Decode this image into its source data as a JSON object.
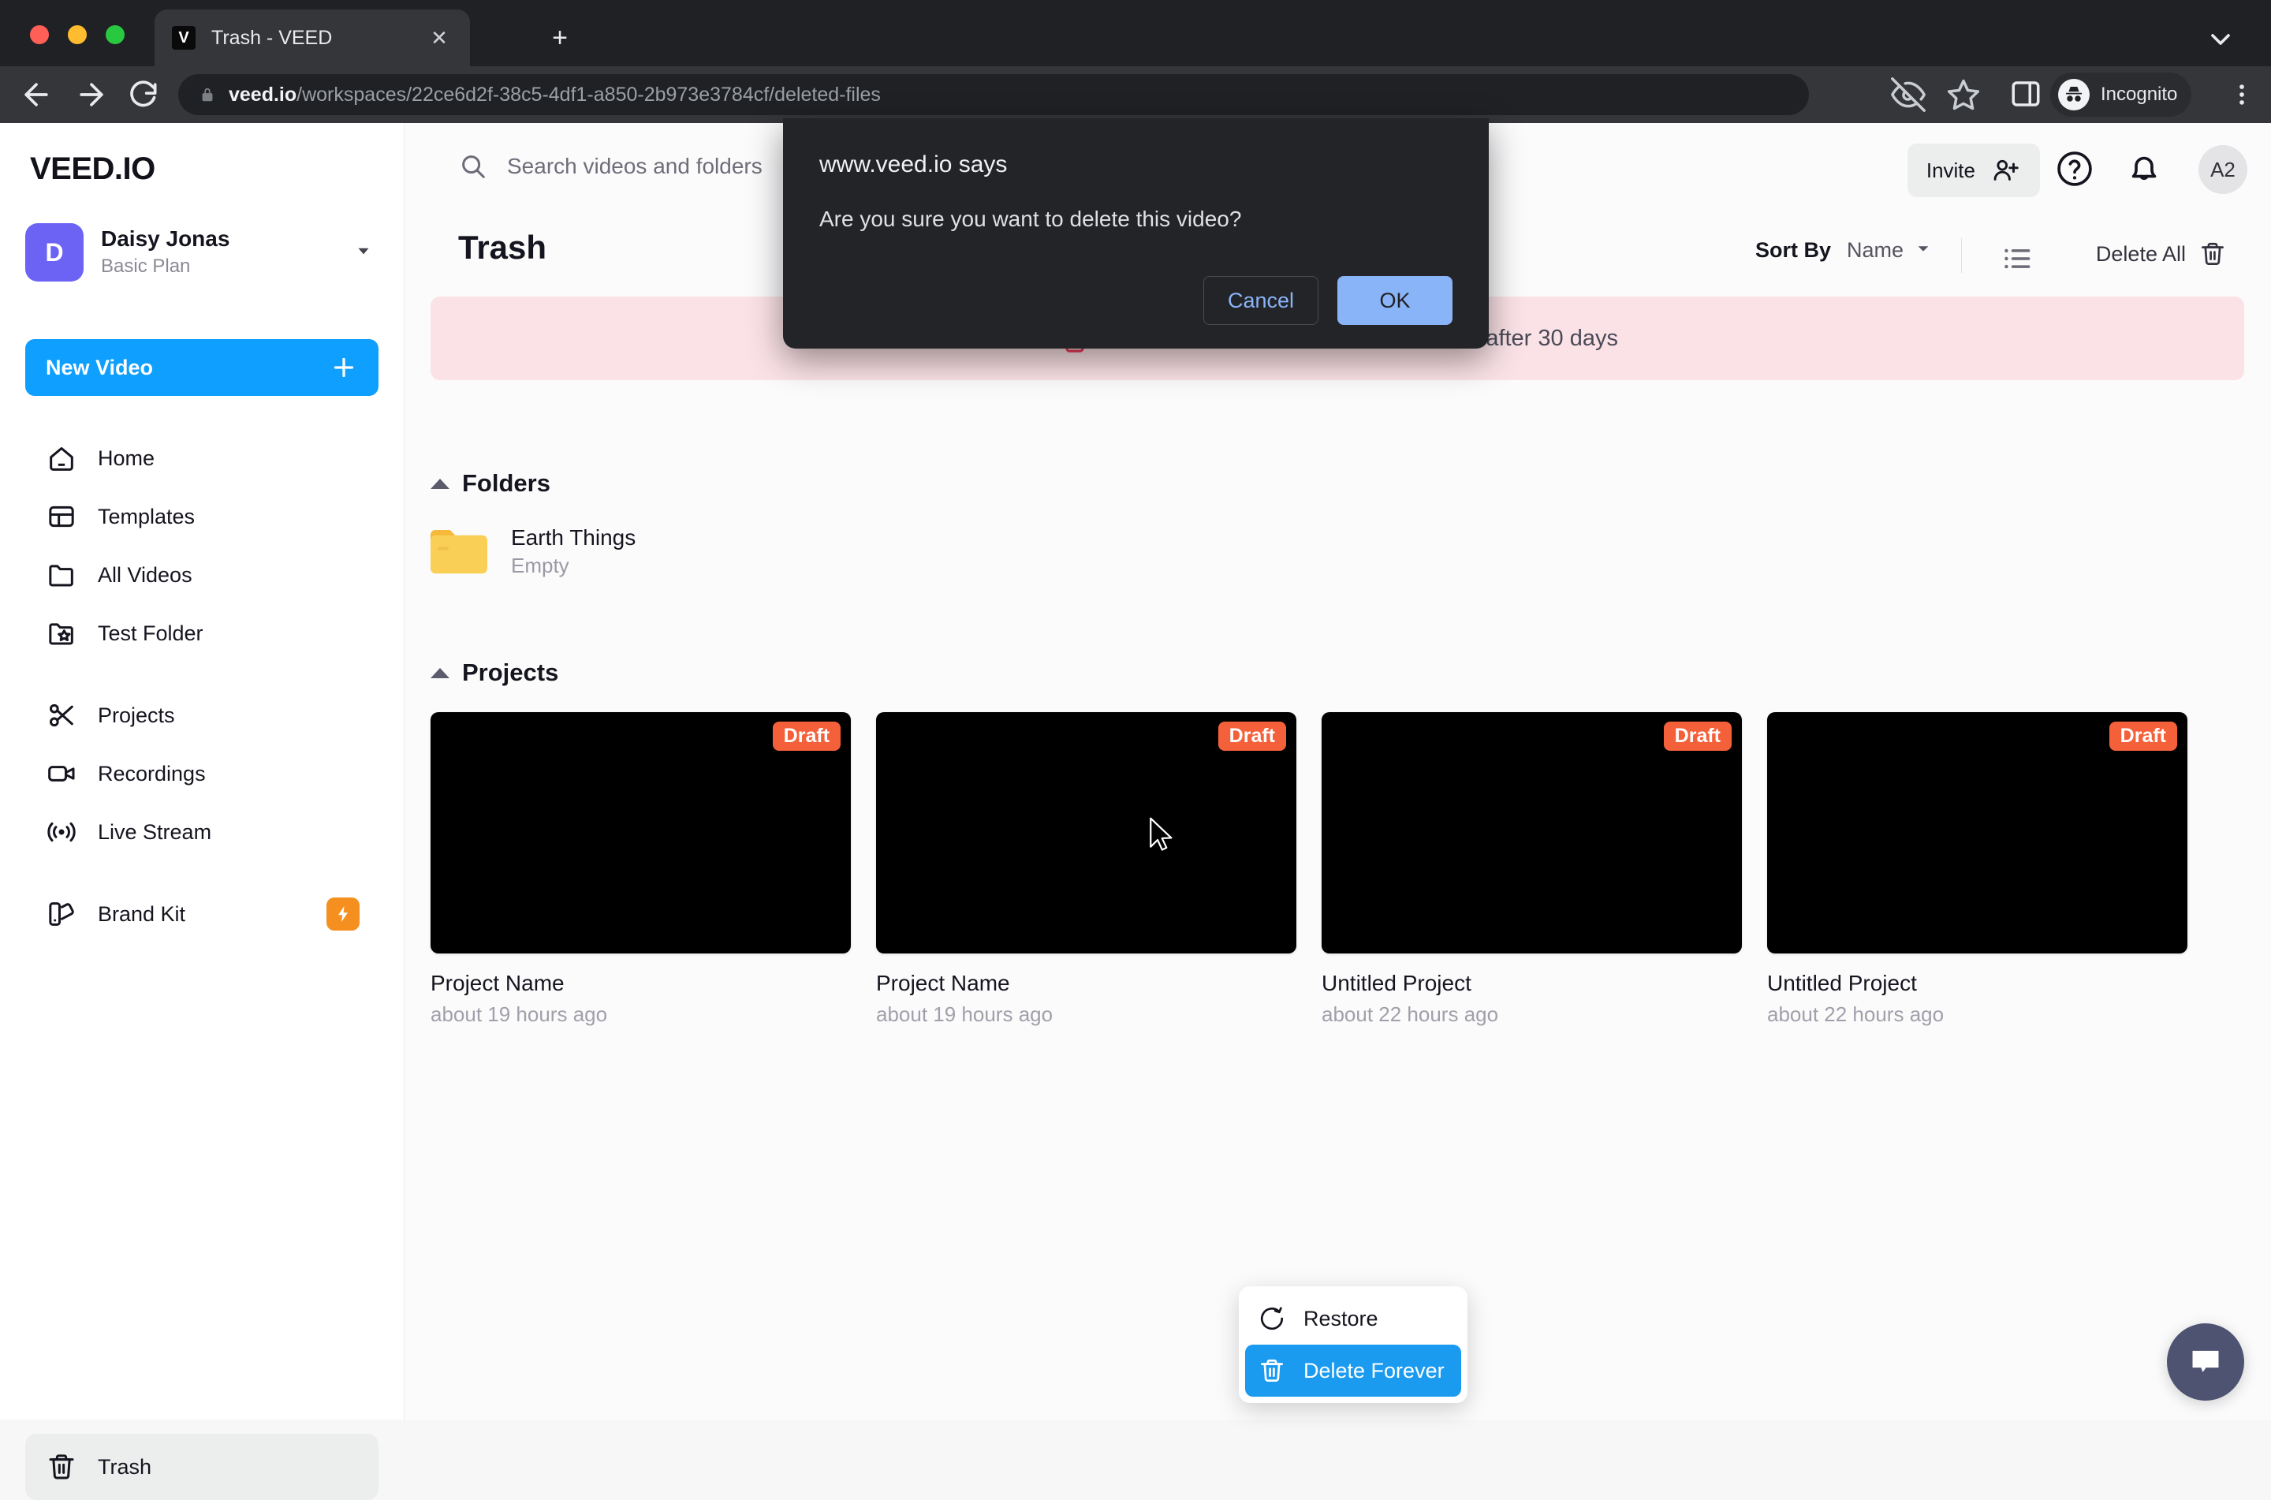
{
  "browser": {
    "tab": {
      "title": "Trash - VEED",
      "favicon_letter": "V"
    },
    "new_tab_label": "+",
    "url_host": "veed.io",
    "url_path": "/workspaces/22ce6d2f-38c5-4df1-a850-2b973e3784cf/deleted-files",
    "profile_label": "Incognito"
  },
  "dialog": {
    "title": "www.veed.io says",
    "message": "Are you sure you want to delete this video?",
    "cancel_label": "Cancel",
    "ok_label": "OK",
    "ok_color": "#8ab4f8"
  },
  "sidebar": {
    "brand": "VEED.IO",
    "account": {
      "initial": "D",
      "name": "Daisy Jonas",
      "plan": "Basic Plan"
    },
    "new_video_label": "New Video",
    "items": [
      {
        "label": "Home",
        "icon": "home-icon"
      },
      {
        "label": "Templates",
        "icon": "templates-icon"
      },
      {
        "label": "All Videos",
        "icon": "folder-icon"
      },
      {
        "label": "Test Folder",
        "icon": "folder-star-icon"
      },
      {
        "label": "Projects",
        "icon": "scissors-icon"
      },
      {
        "label": "Recordings",
        "icon": "video-camera-icon"
      },
      {
        "label": "Live Stream",
        "icon": "broadcast-icon"
      },
      {
        "label": "Brand Kit",
        "icon": "brand-kit-icon",
        "badge": "pro-bolt"
      }
    ],
    "trash_label": "Trash"
  },
  "header": {
    "search_placeholder": "Search videos and folders",
    "invite_label": "Invite",
    "avatar_label": "A2"
  },
  "subbar": {
    "page_title": "Trash",
    "sort_by_label": "Sort By",
    "sort_by_value": "Name",
    "delete_all_label": "Delete All"
  },
  "banner": {
    "text": "Files in the trash are deleted forever after 30 days",
    "bg": "#fbe2e6",
    "icon_color": "#f0395b"
  },
  "folders": {
    "section_label": "Folders",
    "items": [
      {
        "name": "Earth Things",
        "sub": "Empty"
      }
    ]
  },
  "projects": {
    "section_label": "Projects",
    "badge_label": "Draft",
    "badge_color": "#f4603a",
    "items": [
      {
        "name": "Project Name",
        "time": "about 19 hours ago",
        "badge": "Draft"
      },
      {
        "name": "Project Name",
        "time": "about 19 hours ago",
        "badge": "Draft"
      },
      {
        "name": "Untitled Project",
        "time": "about 22 hours ago",
        "badge": "Draft"
      },
      {
        "name": "Untitled Project",
        "time": "about 22 hours ago",
        "badge": "Draft"
      }
    ]
  },
  "context_menu": {
    "restore_label": "Restore",
    "delete_forever_label": "Delete Forever",
    "delete_color": "#1a9bf0"
  }
}
